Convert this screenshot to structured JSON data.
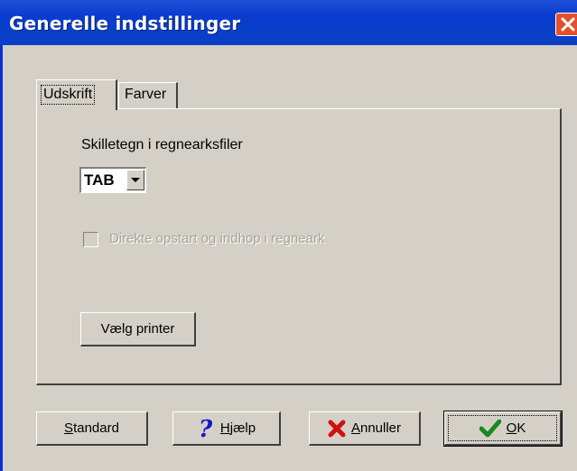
{
  "window": {
    "title": "Generelle indstillinger"
  },
  "tabs": [
    {
      "label": "Udskrift",
      "active": true
    },
    {
      "label": "Farver",
      "active": false
    }
  ],
  "udskrift": {
    "separator_label": "Skilletegn i regnearksfiler",
    "separator_value": "TAB",
    "checkbox_label": "Direkte opstart og indhop i regneark",
    "checkbox_checked": false,
    "checkbox_enabled": false,
    "printer_button": "Vælg printer"
  },
  "buttons": {
    "standard": {
      "mnemonic": "S",
      "rest": "tandard"
    },
    "help": {
      "mnemonic": "H",
      "rest": "jælp"
    },
    "cancel": {
      "mnemonic": "A",
      "rest": "nnuller"
    },
    "ok": {
      "mnemonic": "O",
      "rest": "K"
    }
  },
  "colors": {
    "titlebar": "#0a3ec4",
    "dialog_face": "#d4d0c8",
    "close_button": "#e0522c",
    "help_icon": "#1414c8",
    "cancel_icon": "#d01010",
    "ok_icon": "#1a8a1a"
  },
  "icons": {
    "close": "close-icon",
    "help": "question-mark-icon",
    "cancel": "red-x-icon",
    "ok": "green-check-icon",
    "dropdown": "chevron-down-icon"
  }
}
